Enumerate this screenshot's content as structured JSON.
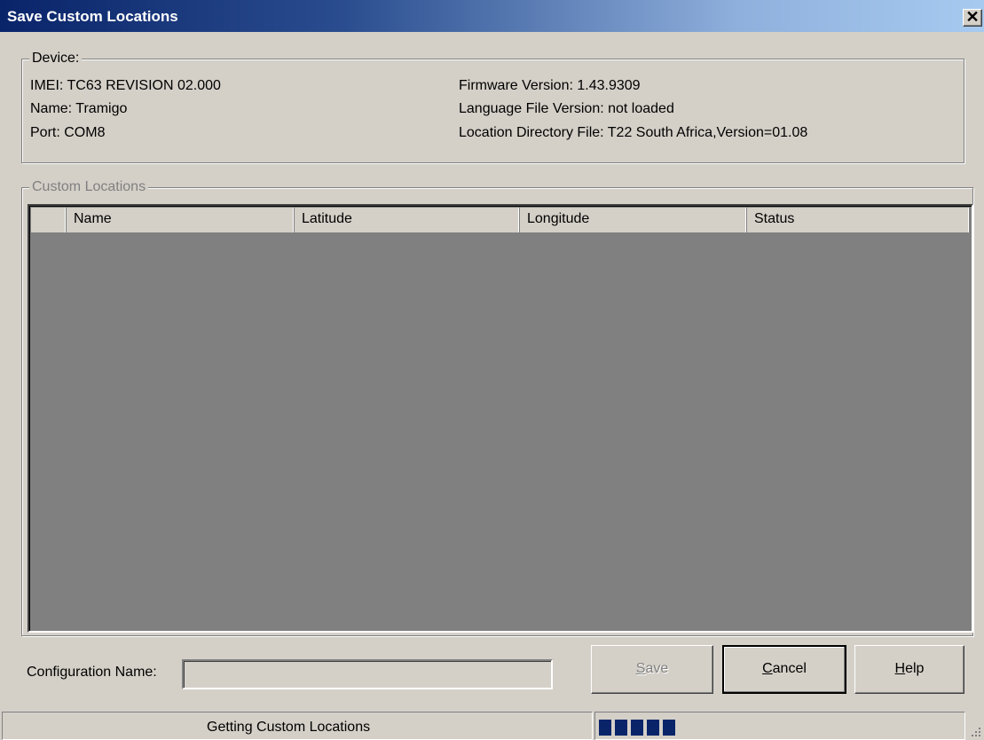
{
  "window": {
    "title": "Save Custom Locations",
    "close_glyph": "✕"
  },
  "device": {
    "legend": "Device:",
    "imei": "IMEI: TC63 REVISION 02.000",
    "name": "Name: Tramigo",
    "port": "Port: COM8",
    "firmware": "Firmware Version: 1.43.9309",
    "language_file": "Language File Version: not loaded",
    "location_directory": "Location Directory File: T22 South Africa,Version=01.08"
  },
  "custom_locations": {
    "legend": "Custom Locations",
    "columns": [
      "Name",
      "Latitude",
      "Longitude",
      "Status"
    ],
    "rows": []
  },
  "configuration": {
    "label_prefix": "Configuration Name:",
    "value": ""
  },
  "buttons": {
    "save": {
      "mnemonic": "S",
      "rest": "ave"
    },
    "cancel": {
      "mnemonic": "C",
      "rest": "ancel"
    },
    "help": {
      "mnemonic": "H",
      "rest": "elp"
    }
  },
  "status": {
    "text": "Getting Custom Locations",
    "progress_blocks": 5
  },
  "colors": {
    "title_gradient_start": "#0a246a",
    "title_gradient_end": "#a6caf0",
    "progress": "#0a246a"
  }
}
